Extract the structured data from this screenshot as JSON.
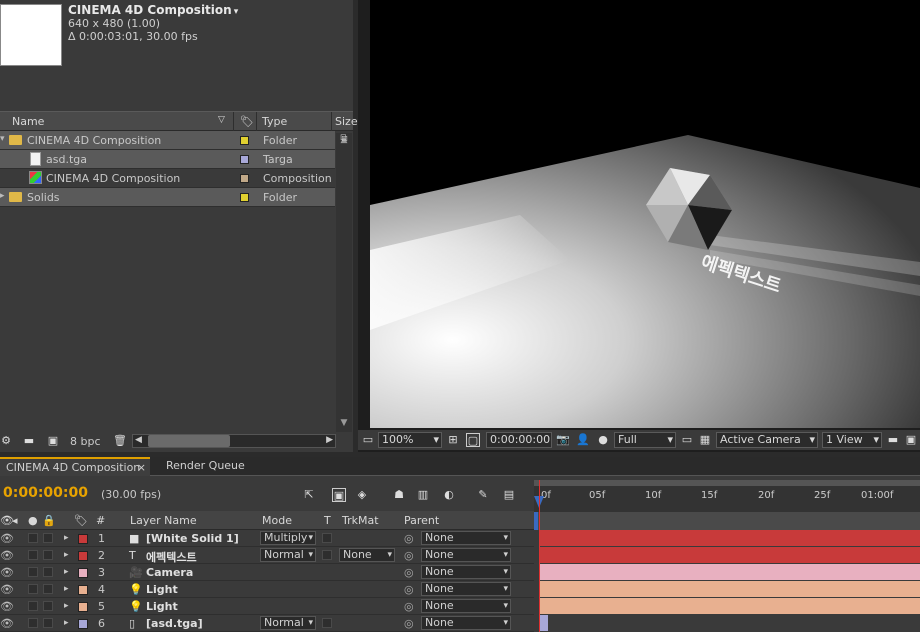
{
  "project": {
    "comp_name": "CINEMA 4D Composition",
    "comp_size": "640 x 480 (1.00)",
    "comp_duration": "Δ 0:00:03:01, 30.00 fps",
    "columns": {
      "name": "Name",
      "type": "Type",
      "size": "Size"
    },
    "items": [
      {
        "name": "CINEMA 4D Composition",
        "type": "Folder",
        "label_color": "#e0d030"
      },
      {
        "name": "asd.tga",
        "type": "Targa",
        "label_color": "#a8a8d8"
      },
      {
        "name": "CINEMA 4D Composition",
        "type": "Composition",
        "label_color": "#c0a888"
      },
      {
        "name": "Solids",
        "type": "Folder",
        "label_color": "#e0d030"
      }
    ],
    "bpc": "8 bpc"
  },
  "viewer": {
    "zoom": "100%",
    "time": "0:00:00:00",
    "resolution": "Full",
    "camera": "Active Camera",
    "view": "1 View",
    "text_overlay": "에펙텍스트"
  },
  "tabs": {
    "comp": "CINEMA 4D Composition",
    "render_queue": "Render Queue"
  },
  "timeline": {
    "timecode": "0:00:00:00",
    "fps": "(30.00 fps)",
    "headers": {
      "num": "#",
      "layer_name": "Layer Name",
      "mode": "Mode",
      "t": "T",
      "trkmat": "TrkMat",
      "parent": "Parent"
    },
    "ruler": [
      "0f",
      "05f",
      "10f",
      "15f",
      "20f",
      "25f",
      "01:00f"
    ],
    "layers": [
      {
        "num": "1",
        "name": "[White Solid 1]",
        "mode": "Multiply",
        "trkmat": "",
        "parent": "None",
        "color": "#c83a3a"
      },
      {
        "num": "2",
        "name": "에펙텍스트",
        "mode": "Normal",
        "trkmat": "None",
        "parent": "None",
        "color": "#c83a3a"
      },
      {
        "num": "3",
        "name": "Camera",
        "mode": "",
        "trkmat": "",
        "parent": "None",
        "color": "#e8b0c0"
      },
      {
        "num": "4",
        "name": "Light",
        "mode": "",
        "trkmat": "",
        "parent": "None",
        "color": "#e8b090"
      },
      {
        "num": "5",
        "name": "Light",
        "mode": "",
        "trkmat": "",
        "parent": "None",
        "color": "#e8b090"
      },
      {
        "num": "6",
        "name": "[asd.tga]",
        "mode": "Normal",
        "trkmat": "",
        "parent": "None",
        "color": "#a8a8d8"
      }
    ]
  }
}
